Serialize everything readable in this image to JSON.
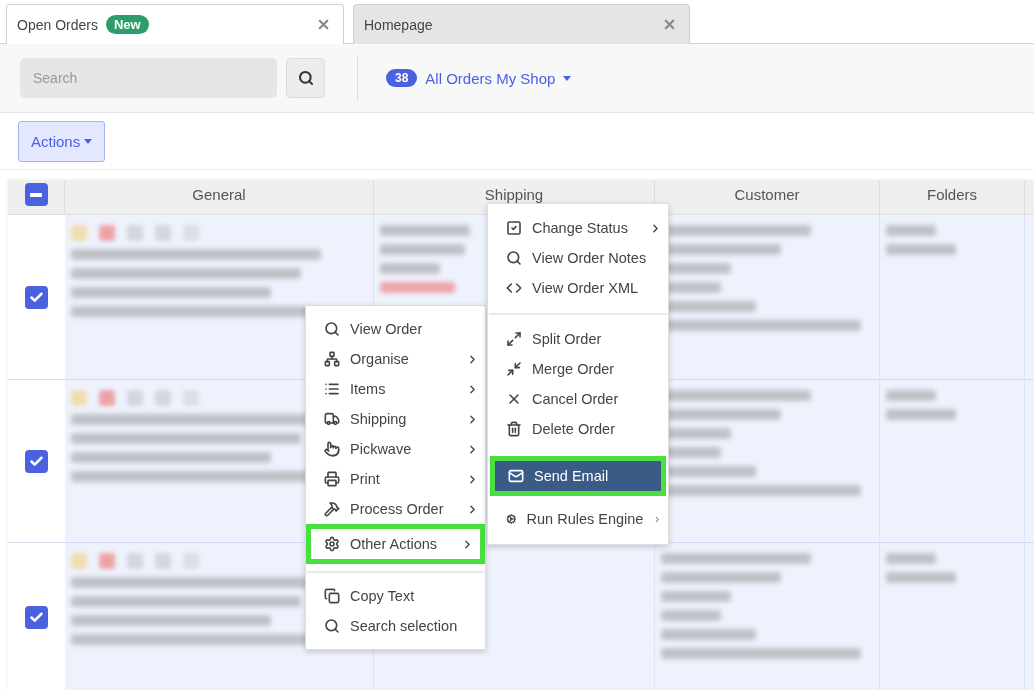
{
  "tabs": [
    {
      "label": "Open Orders",
      "badge": "New",
      "selected": true
    },
    {
      "label": "Homepage",
      "selected": false
    }
  ],
  "toolbar": {
    "search": {
      "placeholder": "Search"
    },
    "view": {
      "count": "38",
      "label": "All Orders My Shop"
    },
    "actions_button": "Actions"
  },
  "table": {
    "header_checkbox": {
      "checked": true,
      "indeterminate": true
    },
    "columns": [
      "General",
      "Shipping",
      "Customer",
      "Folders"
    ],
    "rows": [
      {
        "checked": true
      },
      {
        "checked": true
      },
      {
        "checked": true
      }
    ]
  },
  "context_menu": {
    "items": [
      {
        "kind": "item",
        "label": "View Order",
        "submenu": false,
        "highlighted": false
      },
      {
        "kind": "item",
        "label": "Organise",
        "submenu": true,
        "highlighted": false
      },
      {
        "kind": "item",
        "label": "Items",
        "submenu": true,
        "highlighted": false
      },
      {
        "kind": "item",
        "label": "Shipping",
        "submenu": true,
        "highlighted": false
      },
      {
        "kind": "item",
        "label": "Pickwave",
        "submenu": true,
        "highlighted": false
      },
      {
        "kind": "item",
        "label": "Print",
        "submenu": true,
        "highlighted": false
      },
      {
        "kind": "item",
        "label": "Process Order",
        "submenu": true,
        "highlighted": false
      },
      {
        "kind": "item",
        "label": "Other Actions",
        "submenu": true,
        "highlighted": true
      },
      {
        "kind": "divider"
      },
      {
        "kind": "item",
        "label": "Copy Text",
        "submenu": false,
        "highlighted": false
      },
      {
        "kind": "item",
        "label": "Search selection",
        "submenu": false,
        "highlighted": false
      }
    ]
  },
  "submenu": {
    "items": [
      {
        "kind": "item",
        "label": "Change Status",
        "submenu": true,
        "selected": false,
        "highlighted": false
      },
      {
        "kind": "item",
        "label": "View Order Notes",
        "submenu": false,
        "selected": false,
        "highlighted": false
      },
      {
        "kind": "item",
        "label": "View Order XML",
        "submenu": false,
        "selected": false,
        "highlighted": false
      },
      {
        "kind": "divider"
      },
      {
        "kind": "item",
        "label": "Split Order",
        "submenu": false,
        "selected": false,
        "highlighted": false
      },
      {
        "kind": "item",
        "label": "Merge Order",
        "submenu": false,
        "selected": false,
        "highlighted": false
      },
      {
        "kind": "item",
        "label": "Cancel Order",
        "submenu": false,
        "selected": false,
        "highlighted": false
      },
      {
        "kind": "item",
        "label": "Delete Order",
        "submenu": false,
        "selected": false,
        "highlighted": false
      },
      {
        "kind": "item",
        "label": "Send Email",
        "submenu": false,
        "selected": true,
        "highlighted": true
      },
      {
        "kind": "item",
        "label": "Run Rules Engine",
        "submenu": true,
        "selected": false,
        "highlighted": false
      }
    ]
  }
}
